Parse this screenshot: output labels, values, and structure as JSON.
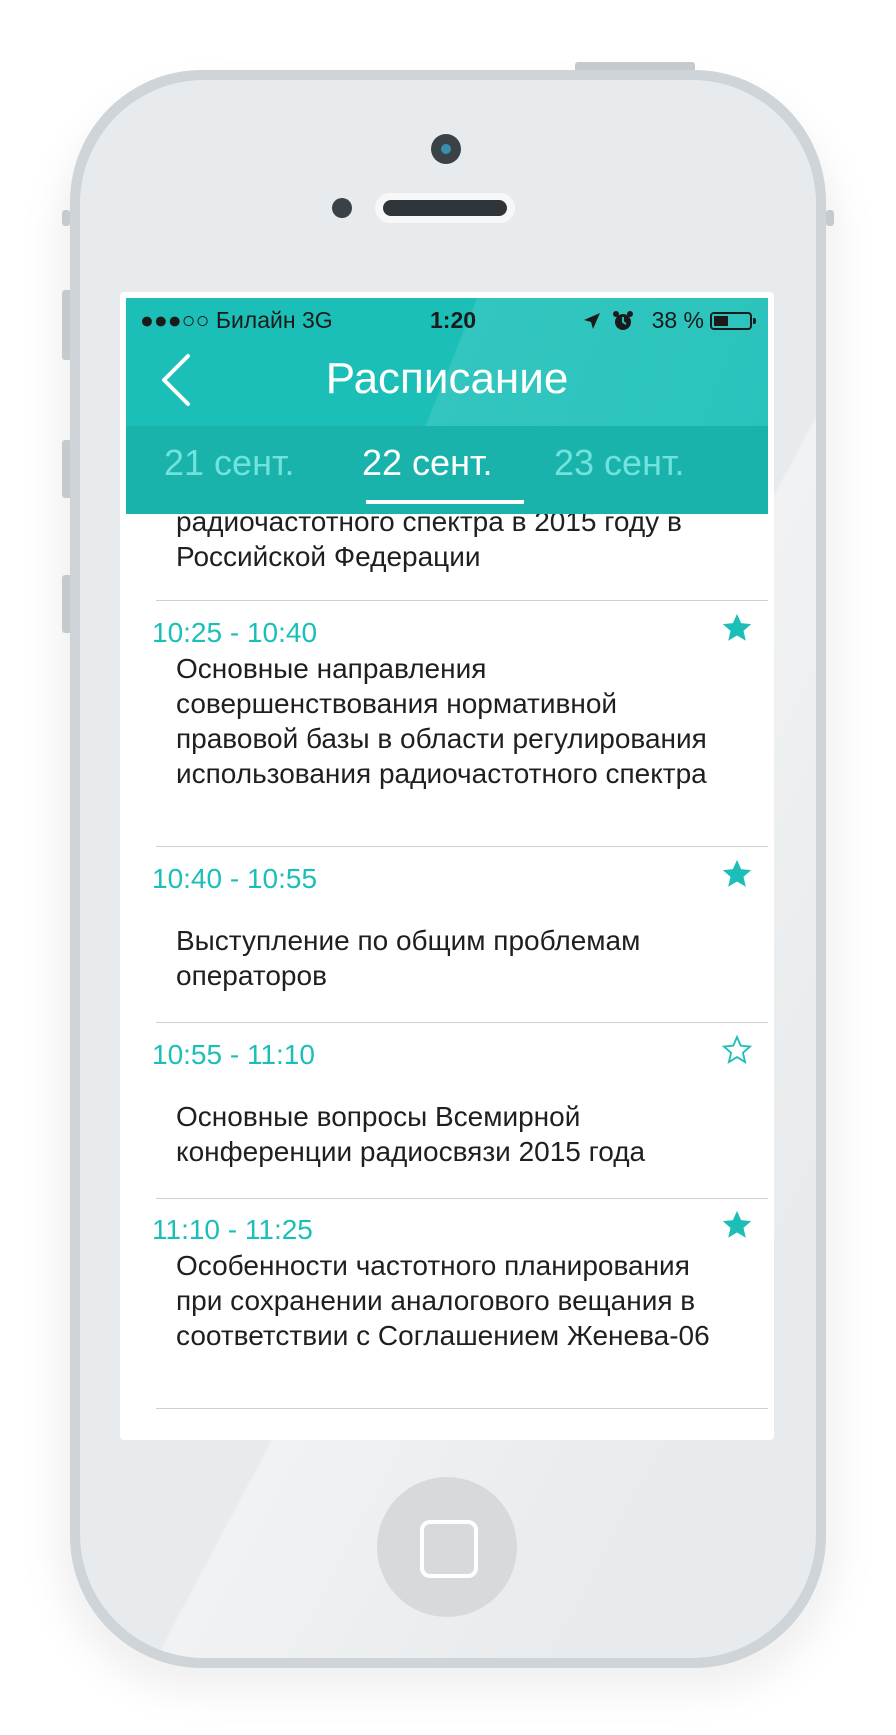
{
  "status_bar": {
    "carrier": "●●●○○ Билайн   3G",
    "time": "1:20",
    "battery": "38 %"
  },
  "nav": {
    "title": "Расписание",
    "back_icon": "chevron-left-icon"
  },
  "tabs": [
    {
      "label": "21 сент.",
      "active": false
    },
    {
      "label": "22 сент.",
      "active": true
    },
    {
      "label": "23 сент.",
      "active": false
    }
  ],
  "schedule": {
    "partial_top": {
      "title": "радиочастотного спектра в 2015 году в\nРоссийской Федерации"
    },
    "items": [
      {
        "time": "10:25 - 10:40",
        "starred": true,
        "title": "Основные направления совершенствования нормативной правовой базы в области регулирования использования радиочастотного спектра"
      },
      {
        "time": "10:40 - 10:55",
        "starred": true,
        "title": "Выступление по общим проблемам операторов"
      },
      {
        "time": "10:55 - 11:10",
        "starred": false,
        "title": "Основные вопросы Всемирной конференции радиосвязи 2015 года"
      },
      {
        "time": "11:10 - 11:25",
        "starred": true,
        "title": "Особенности частотного планирования при сохранении аналогового вещания в соответствии с Соглашением Женева-06"
      }
    ]
  },
  "colors": {
    "accent": "#1cbfb8",
    "tab_bg": "#19b3ac",
    "inactive_tab": "#6fe3dc",
    "text": "#1f1f1f",
    "separator": "#cfcfcf"
  }
}
